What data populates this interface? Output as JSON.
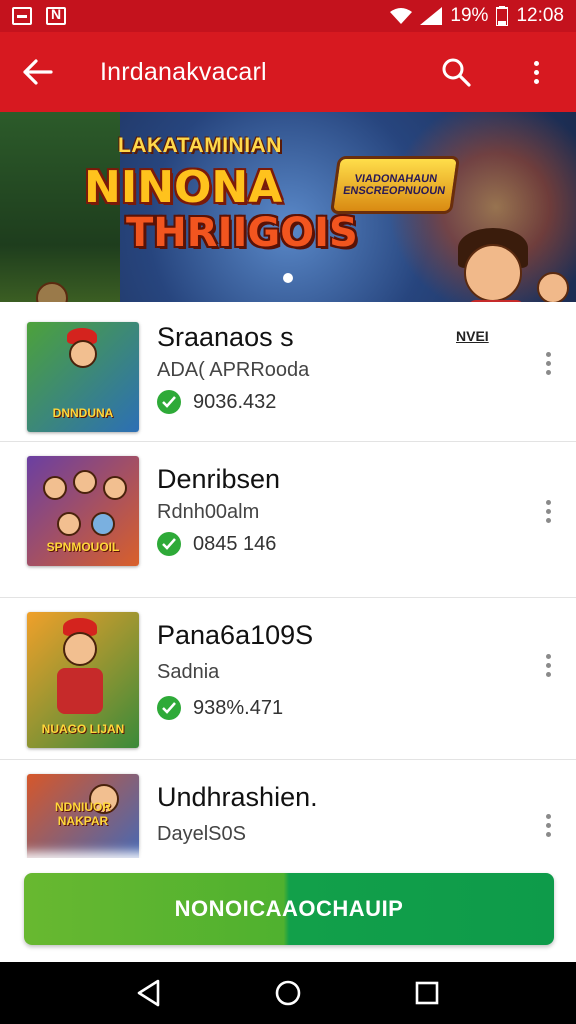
{
  "status_bar": {
    "battery": "19%",
    "time": "12:08"
  },
  "app_bar": {
    "title": "Inrdanakvacarl",
    "icons": [
      "back-arrow-icon",
      "search-icon",
      "more-vert-icon"
    ]
  },
  "banner": {
    "subtitle": "LAKATAMINIAN",
    "title_line1": "NINONA",
    "title_line2": "THRIIGOIS",
    "badge_text": "VIADONAHAUN ENSCREOPNUOUN"
  },
  "games": [
    {
      "title": "Sraanaos s",
      "subtitle": "ADA( APRRooda",
      "meta": "9036.432",
      "tag": "NVEI",
      "thumb_label": "DNNDUNA",
      "thumb_colors": [
        "#4da23a",
        "#2c6fb5"
      ]
    },
    {
      "title": "Denribsen",
      "subtitle": "Rdnh00alm",
      "meta": "0845 146",
      "thumb_label": "SPNMOUOIL",
      "thumb_colors": [
        "#6a3fa2",
        "#d9602a"
      ]
    },
    {
      "title": "Pana6a109S",
      "subtitle": "Sadnia",
      "meta": "938%.471",
      "thumb_label": "NUAGO LIJAN",
      "thumb_colors": [
        "#f0a02a",
        "#3a8a3a"
      ]
    },
    {
      "title": "Undhrashien.",
      "subtitle": "DayelS0S",
      "thumb_label": "NDNIUOR NAKPAR",
      "thumb_colors": [
        "#d6572a",
        "#3a6ac0"
      ]
    }
  ],
  "cta": {
    "label": "NONOICAAOCHAUIP"
  },
  "colors": {
    "primary": "#d71920",
    "status": "#c4121d",
    "check": "#2eaa38",
    "cta_left": "#5cb52f",
    "cta_right": "#0e9b4a"
  }
}
